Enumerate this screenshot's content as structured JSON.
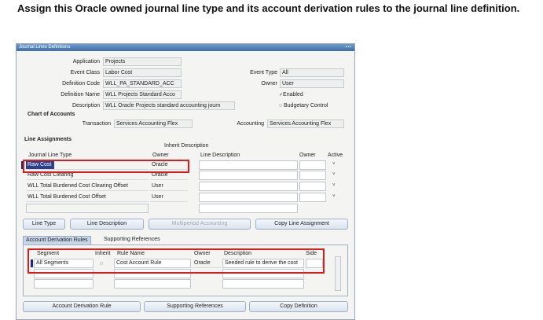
{
  "instruction": "Assign this Oracle owned journal line type and its account derivation rules to the journal line definition.",
  "window": {
    "title": "Journal Lines Definitions"
  },
  "header": {
    "application_label": "Application",
    "application_value": "Projects",
    "event_class_label": "Event Class",
    "event_class_value": "Labor Cost",
    "event_type_label": "Event Type",
    "event_type_value": "All",
    "definition_code_label": "Definition Code",
    "definition_code_value": "WLL_PA_STANDARD_ACC",
    "owner_label": "Owner",
    "owner_value": "User",
    "definition_name_label": "Definition Name",
    "definition_name_value": "WLL Projects Standard Acco",
    "enabled_label": "Enabled",
    "description_label": "Description",
    "description_value": "WLL Oracle Projects standard accounting journ",
    "budgetary_control_label": "Budgetary Control"
  },
  "coa": {
    "heading": "Chart of Accounts",
    "transaction_label": "Transaction",
    "transaction_value": "Services Accounting Flex",
    "accounting_label": "Accounting",
    "accounting_value": "Services Accounting Flex"
  },
  "line_assignments": {
    "heading": "Line Assignments",
    "inherit_desc_header": "Inherit Description",
    "headers": {
      "journal_line_type": "Journal Line Type",
      "owner": "Owner",
      "line_description": "Line Description",
      "owner2": "Owner",
      "active": "Active"
    },
    "rows": [
      {
        "type": "Raw Cost",
        "owner": "Oracle"
      },
      {
        "type": "Raw Cost Clearing",
        "owner": "Oracle"
      },
      {
        "type": "WLL Total Burdened Cost Clearing Offset",
        "owner": "User"
      },
      {
        "type": "WLL Total Burdened Cost Offset",
        "owner": "User"
      }
    ]
  },
  "buttons1": {
    "line_type": "Line Type",
    "line_description": "Line Description",
    "multiperiod": "Multiperiod Accounting",
    "copy_line": "Copy Line Assignment"
  },
  "tabs": {
    "account_derivation": "Account Derivation Rules",
    "supporting_references": "Supporting References"
  },
  "adr": {
    "headers": {
      "segment": "Segment",
      "inherit": "Inherit",
      "rule_name": "Rule Name",
      "owner": "Owner",
      "description": "Description",
      "side": "Side"
    },
    "row": {
      "segment": "All Segments",
      "rule_name": "Cost Account Rule",
      "owner": "Oracle",
      "description": "Seeded rule to derive the cost"
    }
  },
  "buttons2": {
    "account_derivation_rule": "Account Derivation Rule",
    "supporting_references": "Supporting References",
    "copy_definition": "Copy Definition"
  },
  "colors": {
    "highlight_red": "#e01b1b",
    "selection_blue": "#2b3f8f",
    "title_bar": "#4f7fb8"
  }
}
